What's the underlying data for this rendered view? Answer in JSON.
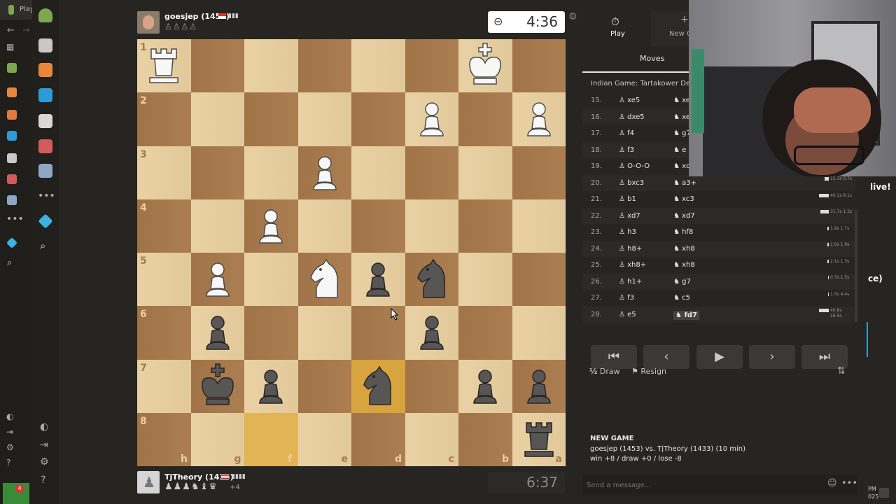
{
  "browser": {
    "tab_label": "Play"
  },
  "opponent": {
    "name": "goesjep (1453)",
    "captured": "♙♙♙♙",
    "clock": "4:36"
  },
  "player": {
    "name": "TjTheory (1433)",
    "captured": "♟♟♟♞♝♛",
    "advantage": "+4",
    "clock": "6:37"
  },
  "board": {
    "ranks": [
      "1",
      "2",
      "3",
      "4",
      "5",
      "6",
      "7",
      "8"
    ],
    "files": [
      "h",
      "g",
      "f",
      "e",
      "d",
      "c",
      "b",
      "a"
    ],
    "orientation": "black"
  },
  "panel": {
    "play_label": "Play",
    "new_game_label": "New G",
    "moves_tab": "Moves",
    "opening": "Indian Game: Tartakower Defer",
    "moves": [
      {
        "n": "15.",
        "w": "xe5",
        "b": "xe"
      },
      {
        "n": "16.",
        "w": "dxe5",
        "b": "xe"
      },
      {
        "n": "17.",
        "w": "f4",
        "b": "g7"
      },
      {
        "n": "18.",
        "w": "f3",
        "b": "e"
      },
      {
        "n": "19.",
        "w": "O-O-O",
        "b": "xc"
      },
      {
        "n": "20.",
        "w": "bxc3",
        "b": "a3+"
      },
      {
        "n": "21.",
        "w": "b1",
        "b": "xc3"
      },
      {
        "n": "22.",
        "w": "xd7",
        "b": "xd7"
      },
      {
        "n": "23.",
        "w": "h3",
        "b": "hf8"
      },
      {
        "n": "24.",
        "w": "h8+",
        "b": "xh8"
      },
      {
        "n": "25.",
        "w": "xh8+",
        "b": "xh8"
      },
      {
        "n": "26.",
        "w": "h1+",
        "b": "g7"
      },
      {
        "n": "27.",
        "w": "f3",
        "b": "c5"
      },
      {
        "n": "28.",
        "w": "e5",
        "b": "fd7"
      }
    ],
    "times": [
      [
        "15.3s",
        "0.7s"
      ],
      [
        "40.1s",
        "8.1s"
      ],
      [
        "31.7s",
        "1.3s"
      ],
      [
        "1.8s",
        "1.7s"
      ],
      [
        "2.6s",
        "1.9s"
      ],
      [
        "2.1s",
        "1.3s"
      ],
      [
        "0.7s",
        "1.5s"
      ],
      [
        "1.5s",
        "4.4s"
      ],
      [
        "40.8s",
        "16.9s"
      ]
    ],
    "draw_label": "Draw",
    "resign_label": "Resign",
    "new_game_title": "NEW GAME",
    "new_game_desc": "goesjep (1453) vs. TjTheory (1433) (10 min)",
    "new_game_score": "win +8 / draw +0 / lose -8",
    "message_placeholder": "Send a message..."
  },
  "overlay": {
    "live_text": "live!",
    "side_text": "ce)"
  },
  "taskbar": {
    "badge": "4",
    "time_fragment": "PM",
    "year_fragment": "025"
  },
  "colors": {
    "board_light": "#e9cfa0",
    "board_dark": "#a97a4c",
    "highlight": "#d8a43d",
    "bg": "#262522"
  }
}
